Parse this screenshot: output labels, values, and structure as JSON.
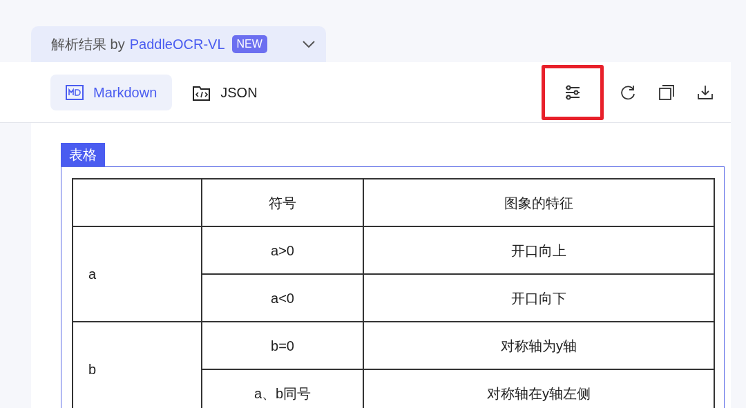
{
  "header": {
    "title": "解析结果 by",
    "model": "PaddleOCR-VL",
    "badge": "NEW"
  },
  "view_tabs": [
    {
      "kind": "markdown",
      "label": "Markdown",
      "selected": true
    },
    {
      "kind": "json",
      "label": "JSON",
      "selected": false
    }
  ],
  "toolbar": [
    {
      "kind": "settings",
      "highlighted": true
    },
    {
      "kind": "refresh",
      "highlighted": false
    },
    {
      "kind": "copy",
      "highlighted": false
    },
    {
      "kind": "download",
      "highlighted": false
    }
  ],
  "block": {
    "label": "表格",
    "columns": [
      "符号",
      "图象的特征"
    ],
    "groups": [
      {
        "label": "a",
        "rows": [
          {
            "symbol": "a>0",
            "feature": "开口向上"
          },
          {
            "symbol": "a<0",
            "feature": "开口向下"
          }
        ]
      },
      {
        "label": "b",
        "rows": [
          {
            "symbol": "b=0",
            "feature": "对称轴为y轴"
          },
          {
            "symbol": "a、b同号",
            "feature": "对称轴在y轴左侧"
          }
        ]
      }
    ]
  }
}
